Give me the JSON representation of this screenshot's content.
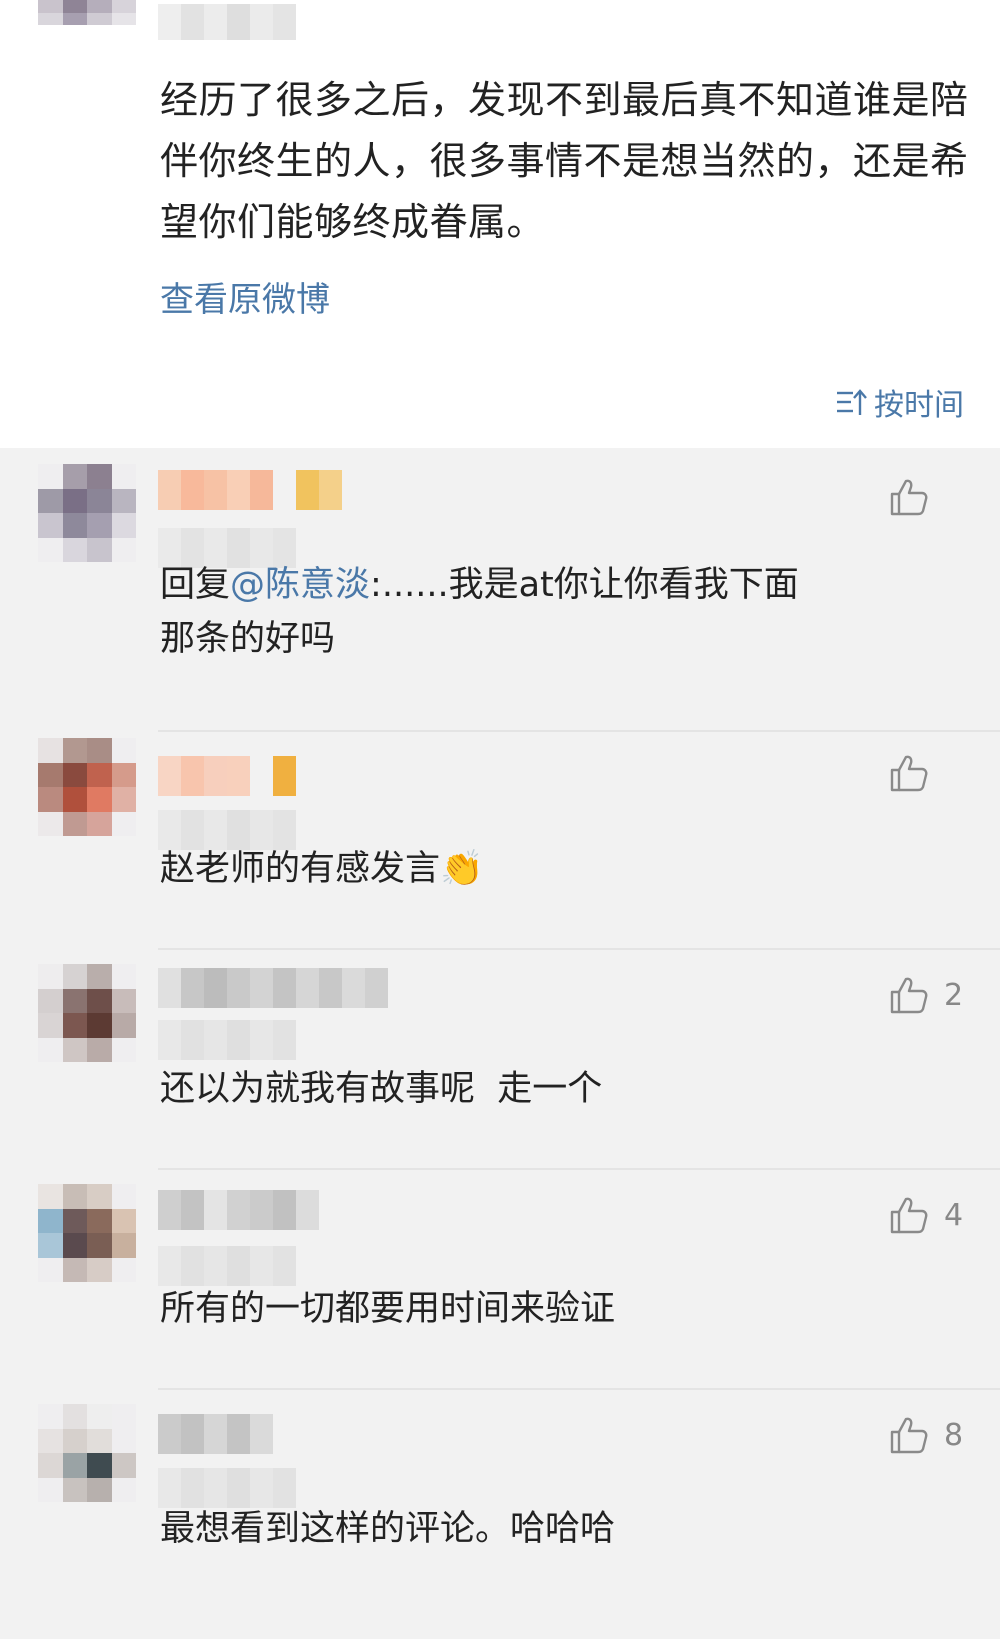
{
  "post": {
    "text": "经历了很多之后，发现不到最后真不知道谁是陪伴你终生的人，很多事情不是想当然的，还是希望你们能够终成眷属。",
    "view_original": "查看原微博",
    "sort_label": "按时间"
  },
  "comments": [
    {
      "prefix": "回复",
      "mention": "@陈意淡",
      "text": ":......我是at你让你看我下面那条的好吗",
      "likes": ""
    },
    {
      "prefix": "",
      "mention": "",
      "text": "赵老师的有感发言👏",
      "likes": ""
    },
    {
      "prefix": "",
      "mention": "",
      "text": "还以为就我有故事呢  走一个",
      "likes": "2"
    },
    {
      "prefix": "",
      "mention": "",
      "text": "所有的一切都要用时间来验证",
      "likes": "4"
    },
    {
      "prefix": "",
      "mention": "",
      "text": "最想看到这样的评论。哈哈哈",
      "likes": "8"
    }
  ],
  "colors": {
    "link": "#4a78a8",
    "text": "#222222",
    "section_bg": "#f2f2f2",
    "like_icon": "#8a8a8a"
  },
  "icons": {
    "sort": "sort-time-icon",
    "like": "thumbs-up-icon"
  }
}
